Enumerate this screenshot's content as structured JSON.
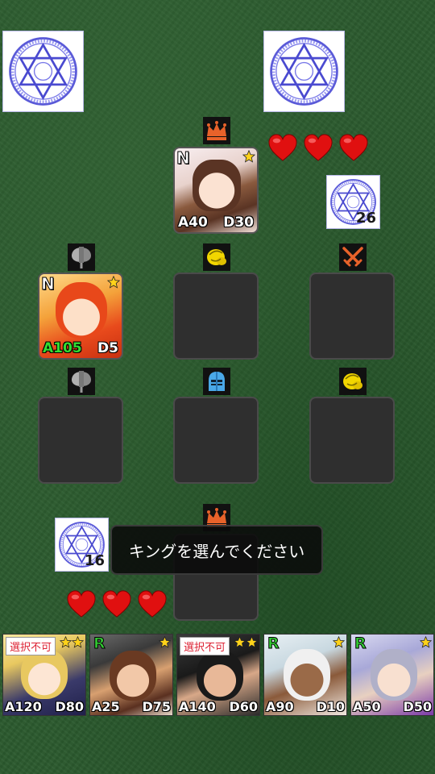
{
  "colors": {
    "felt": "#2b5a2e",
    "slot": "#2f2f2f",
    "heart": "#e01010",
    "crown": "#e8622a",
    "glove": "#f2d600",
    "sword": "#e8622a",
    "knight": "#4aa8e8",
    "axe": "#9a9a9a",
    "atk_boost": "#33dd33",
    "unselectable": "#dd2233"
  },
  "opponent": {
    "deck_left": {
      "icon": "hexagram-icon"
    },
    "deck_right": {
      "icon": "hexagram-icon"
    },
    "small_deck": {
      "icon": "hexagram-icon",
      "count": "26"
    },
    "hearts": 3,
    "king": {
      "rarity": "N",
      "atk": "A40",
      "def": "D30",
      "stars": 1
    },
    "role_icons": [
      "crown-icon"
    ]
  },
  "board": {
    "row1_roles": [
      "axe-icon",
      "glove-icon",
      "swords-icon"
    ],
    "row1_card": {
      "rarity": "N",
      "atk": "A105",
      "def": "D5",
      "stars": 1
    },
    "row2_roles": [
      "axe-icon",
      "knight-helmet-icon",
      "glove-icon"
    ]
  },
  "player": {
    "king_role": "crown-icon",
    "deck": {
      "icon": "hexagram-icon",
      "count": "16"
    },
    "hearts": 3
  },
  "message": "キングを選んでください",
  "hand": [
    {
      "tag": "選択不可",
      "rarity": "",
      "stars": 2,
      "atk": "A120",
      "def": "D80"
    },
    {
      "tag": "",
      "rarity": "R",
      "stars": 1,
      "atk": "A25",
      "def": "D75"
    },
    {
      "tag": "選択不可",
      "rarity": "",
      "stars": 2,
      "atk": "A140",
      "def": "D60"
    },
    {
      "tag": "",
      "rarity": "R",
      "stars": 1,
      "atk": "A90",
      "def": "D10"
    },
    {
      "tag": "",
      "rarity": "R",
      "stars": 1,
      "atk": "A50",
      "def": "D50"
    }
  ]
}
